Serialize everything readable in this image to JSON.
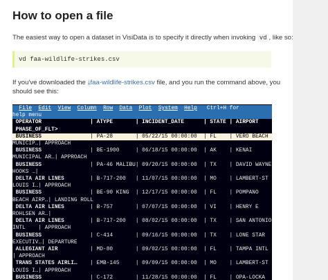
{
  "heading": "How to open a file",
  "intro": {
    "text_before": "The easiest way to open a dataset in VisiData is to specify it directly when invoking ",
    "code": "vd",
    "text_after": ", like so:"
  },
  "command": "vd faa-wildlife-strikes.csv",
  "download_para": {
    "text_before": "If you've downloaded the ",
    "link_icon": "download-icon",
    "link_text": "faa-wildlife-strikes.csv",
    "text_after": " file, and you run the command above, you should see this:"
  },
  "terminal": {
    "menus": [
      "File",
      "Edit",
      "View",
      "Column",
      "Row",
      "Data",
      "Plot",
      "System",
      "Help"
    ],
    "help_hint": "Ctrl+H for",
    "help_line": "help menu",
    "columns": [
      "OPERATOR",
      "ATYPE",
      "INCIDENT_DATE",
      "STATE",
      "AIRPORT"
    ],
    "columns2": [
      "PHASE_OF_FLT"
    ],
    "rows": [
      {
        "operator": "BUSINESS",
        "atype": "PA-28",
        "date": "05/22/15 00:00:00",
        "state": "FL",
        "airport": "VERO BEACH",
        "cont": "MUNICIP…| APPROACH",
        "bold": true,
        "cursor": true
      },
      {
        "operator": "BUSINESS",
        "atype": "BE-1900",
        "date": "06/18/15 00:00:00",
        "state": "AK",
        "airport": "KENAI",
        "cont": "MUNICIPAL AR…| APPROACH",
        "bold": true,
        "cursor": false
      },
      {
        "operator": "BUSINESS",
        "atype": "PA-46 MALIBU",
        "date": "09/20/15 00:00:00",
        "state": "TX",
        "airport": "DAVID WAYNE",
        "cont": "HOOKS …|",
        "bold": true,
        "cursor": false
      },
      {
        "operator": "DELTA AIR LINES",
        "atype": "B-717-200",
        "date": "11/07/15 00:00:00",
        "state": "MO",
        "airport": "LAMBERT-ST",
        "cont": "LOUIS I…| APPROACH",
        "bold": true,
        "cursor": false
      },
      {
        "operator": "BUSINESS",
        "atype": "BE-90 KING",
        "date": "12/17/15 00:00:00",
        "state": "FL",
        "airport": "POMPANO",
        "cont": "BEACH AIRP…| LANDING ROLL",
        "bold": true,
        "cursor": false
      },
      {
        "operator": "DELTA AIR LINES",
        "atype": "B-757",
        "date": "07/07/15 00:00:00",
        "state": "VI",
        "airport": "HENRY E",
        "cont": "ROHLSEN AR…|",
        "bold": true,
        "cursor": false
      },
      {
        "operator": "DELTA AIR LINES",
        "atype": "B-717-200",
        "date": "08/02/15 00:00:00",
        "state": "TX",
        "airport": "SAN ANTONIO",
        "cont": "INTL    | APPROACH",
        "bold": true,
        "cursor": false
      },
      {
        "operator": "BUSINESS",
        "atype": "C-414",
        "date": "09/16/15 00:00:00",
        "state": "TX",
        "airport": "LONE STAR",
        "cont": "EXECUTIV…| DEPARTURE",
        "bold": true,
        "cursor": false
      },
      {
        "operator": "ALLEGIANT AIR",
        "atype": "MD-80",
        "date": "09/02/15 00:00:00",
        "state": "FL",
        "airport": "TAMPA INTL",
        "cont": "| APPROACH",
        "bold": true,
        "cursor": false
      },
      {
        "operator": "TRANS STATES AIRLI…",
        "atype": "EMB-145",
        "date": "09/09/15 00:00:00",
        "state": "MO",
        "airport": "LAMBERT-ST",
        "cont": "LOUIS I…| APPROACH",
        "bold": true,
        "cursor": false
      },
      {
        "operator": "BUSINESS",
        "atype": "C-172",
        "date": "11/28/15 00:00:00",
        "state": "FL",
        "airport": "OPA-LOCKA",
        "cont": "",
        "bold": true,
        "cursor": false
      }
    ]
  }
}
